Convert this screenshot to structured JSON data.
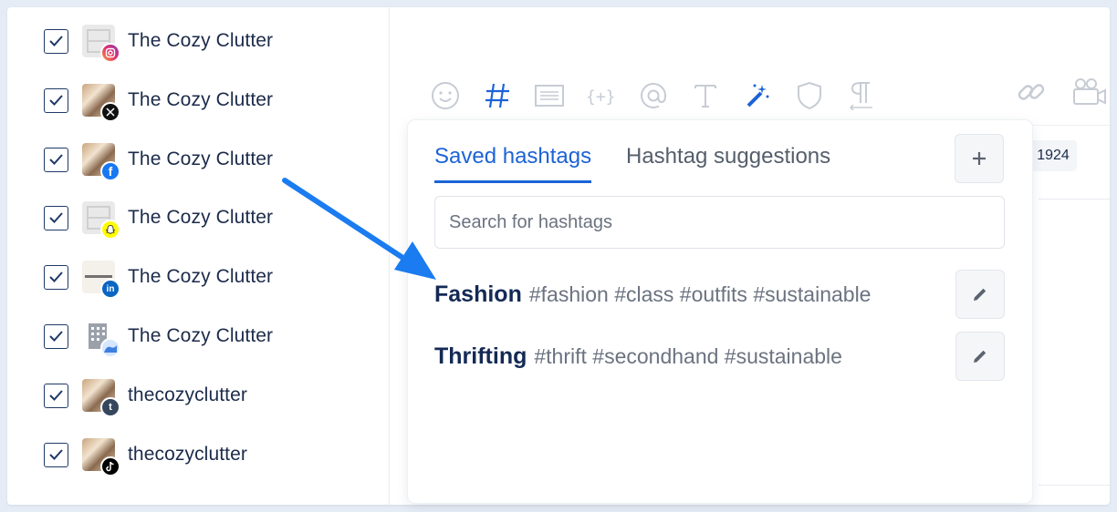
{
  "accounts": [
    {
      "name": "The Cozy Clutter",
      "network": "instagram",
      "checked": true
    },
    {
      "name": "The Cozy Clutter",
      "network": "x",
      "checked": true
    },
    {
      "name": "The Cozy Clutter",
      "network": "facebook",
      "checked": true
    },
    {
      "name": "The Cozy Clutter",
      "network": "snapchat",
      "checked": true
    },
    {
      "name": "The Cozy Clutter",
      "network": "linkedin",
      "checked": true
    },
    {
      "name": "The Cozy Clutter",
      "network": "google-business",
      "checked": true
    },
    {
      "name": "thecozyclutter",
      "network": "tumblr",
      "checked": true
    },
    {
      "name": "thecozyclutter",
      "network": "tiktok",
      "checked": true
    }
  ],
  "toolbar": {
    "icons": [
      "emoji-icon",
      "hashtag-icon",
      "text-block-icon",
      "variable-icon",
      "mention-icon",
      "text-format-icon",
      "magic-wand-icon",
      "shield-icon",
      "paragraph-icon",
      "link-icon",
      "video-icon"
    ]
  },
  "background_chip": "1924",
  "hashtags_panel": {
    "tabs": [
      {
        "label": "Saved hashtags",
        "active": true
      },
      {
        "label": "Hashtag suggestions",
        "active": false
      }
    ],
    "search_placeholder": "Search for hashtags",
    "groups": [
      {
        "name": "Fashion",
        "tags": "#fashion #class #outfits #sustainable"
      },
      {
        "name": "Thrifting",
        "tags": "#thrift #secondhand #sustainable"
      }
    ]
  },
  "colors": {
    "accent": "#1c63d6",
    "group_name": "#142a55",
    "tag_text": "#6b7380",
    "arrow": "#1a7cf0"
  }
}
